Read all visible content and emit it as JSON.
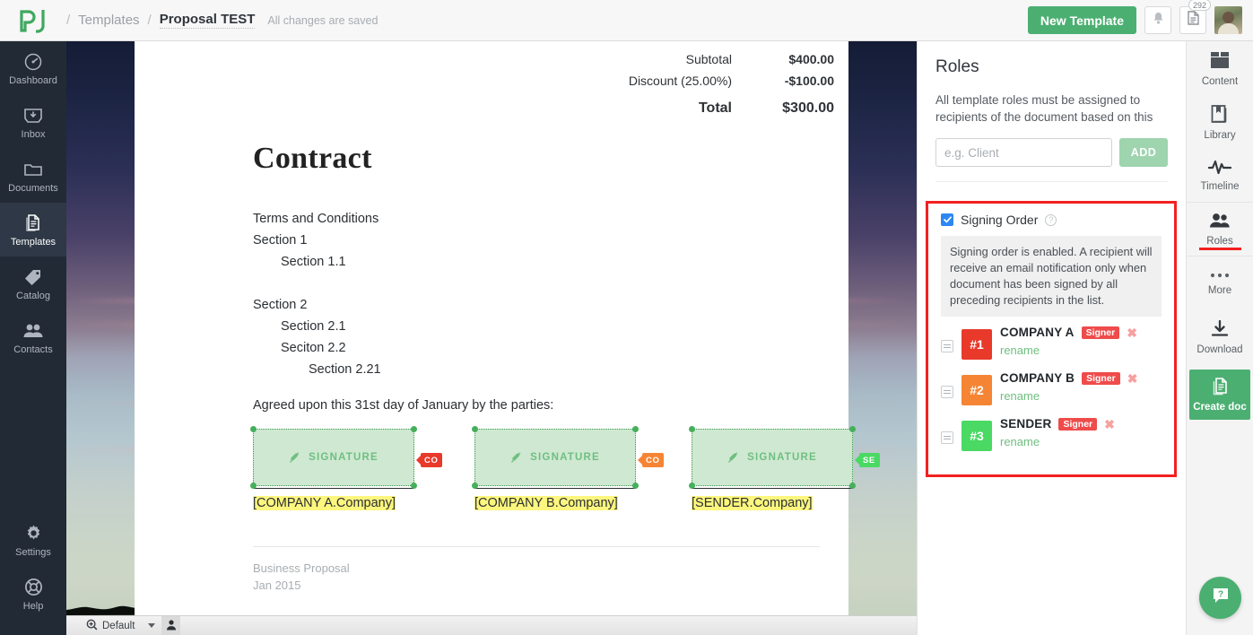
{
  "topbar": {
    "logo": "pandadoc-logo",
    "breadcrumb": {
      "sep": "/",
      "templates": "Templates",
      "current": "Proposal TEST"
    },
    "save_status": "All changes are saved",
    "new_template_label": "New Template",
    "notifications_icon": "bell-icon",
    "docs_icon": "document-icon",
    "docs_badge": "292",
    "avatar": "user-avatar"
  },
  "sidebar": {
    "items": [
      {
        "label": "Dashboard",
        "icon": "gauge-icon"
      },
      {
        "label": "Inbox",
        "icon": "inbox-icon"
      },
      {
        "label": "Documents",
        "icon": "folder-icon"
      },
      {
        "label": "Templates",
        "icon": "templates-icon"
      },
      {
        "label": "Catalog",
        "icon": "tag-icon"
      },
      {
        "label": "Contacts",
        "icon": "contacts-icon"
      }
    ],
    "bottom_items": [
      {
        "label": "Settings",
        "icon": "gear-icon"
      },
      {
        "label": "Help",
        "icon": "lifebuoy-icon"
      }
    ]
  },
  "document": {
    "totals": [
      {
        "label": "Subtotal",
        "value": "$400.00",
        "emphasis": false
      },
      {
        "label": "Discount (25.00%)",
        "value": "-$100.00",
        "emphasis": false
      },
      {
        "label": "Total",
        "value": "$300.00",
        "emphasis": true
      }
    ],
    "title": "Contract",
    "lines": [
      {
        "text": "Terms and Conditions",
        "indent": 0
      },
      {
        "text": "Section 1",
        "indent": 0
      },
      {
        "text": "Section 1.1",
        "indent": 1
      },
      {
        "text": "",
        "indent": 0
      },
      {
        "text": "Section 2",
        "indent": 0
      },
      {
        "text": "Section 2.1",
        "indent": 1
      },
      {
        "text": "Seciton 2.2",
        "indent": 1
      },
      {
        "text": "Section 2.21",
        "indent": 2
      }
    ],
    "agreed_text": "Agreed upon this 31st day of January by the parties:",
    "signature_label": "SIGNATURE",
    "signature_icon": "pen-icon",
    "signatures": [
      {
        "tag": "CO",
        "tag_color": "#e8392b",
        "token": "[COMPANY A.Company]",
        "selected": true
      },
      {
        "tag": "CO",
        "tag_color": "#f58534",
        "token": "[COMPANY B.Company]",
        "selected": true
      },
      {
        "tag": "SE",
        "tag_color": "#4ad963",
        "token": "[SENDER.Company]",
        "selected": true
      }
    ],
    "footer": [
      "Business Proposal",
      "Jan 2015"
    ]
  },
  "bottombar": {
    "zoom_icon": "zoom-in-icon",
    "zoom_label": "Default",
    "person_icon": "person-icon"
  },
  "roles_panel": {
    "title": "Roles",
    "description": "All template roles must be assigned to recipients of the document based on this",
    "input_value": "",
    "input_placeholder": "e.g. Client",
    "add_label": "ADD",
    "signing_order": {
      "label": "Signing Order",
      "checked": true,
      "help_icon": "question-icon",
      "note": "Signing order is enabled. A recipient will receive an email notification only when document has been signed by all preceding recipients in the list."
    },
    "roles": [
      {
        "num": "#1",
        "color": "#e8392b",
        "name": "COMPANY A",
        "badge": "Signer",
        "rename": "rename",
        "remove_icon": "close-icon",
        "drag_icon": "drag-handle-icon"
      },
      {
        "num": "#2",
        "color": "#f58534",
        "name": "COMPANY B",
        "badge": "Signer",
        "rename": "rename",
        "remove_icon": "close-icon",
        "drag_icon": "drag-handle-icon"
      },
      {
        "num": "#3",
        "color": "#4ad963",
        "name": "SENDER",
        "badge": "Signer",
        "rename": "rename",
        "remove_icon": "close-icon",
        "drag_icon": "drag-handle-icon"
      }
    ]
  },
  "right_toolbar": {
    "items": [
      {
        "label": "Content",
        "icon": "content-blocks-icon",
        "active": false
      },
      {
        "label": "Library",
        "icon": "book-icon",
        "active": false
      },
      {
        "label": "Timeline",
        "icon": "pulse-icon",
        "active": false
      },
      {
        "label": "Roles",
        "icon": "people-icon",
        "active": true
      },
      {
        "label": "More",
        "icon": "ellipsis-icon",
        "active": false
      },
      {
        "label": "Download",
        "icon": "download-icon",
        "active": false
      }
    ],
    "create_doc": {
      "label": "Create doc",
      "icon": "documents-icon"
    },
    "help_fab": {
      "icon": "chat-question-icon"
    }
  },
  "colors": {
    "brand_green": "#4caf72",
    "highlight_red": "#f32020",
    "checkbox_blue": "#2d87f0",
    "token_yellow": "#fdf67e"
  }
}
